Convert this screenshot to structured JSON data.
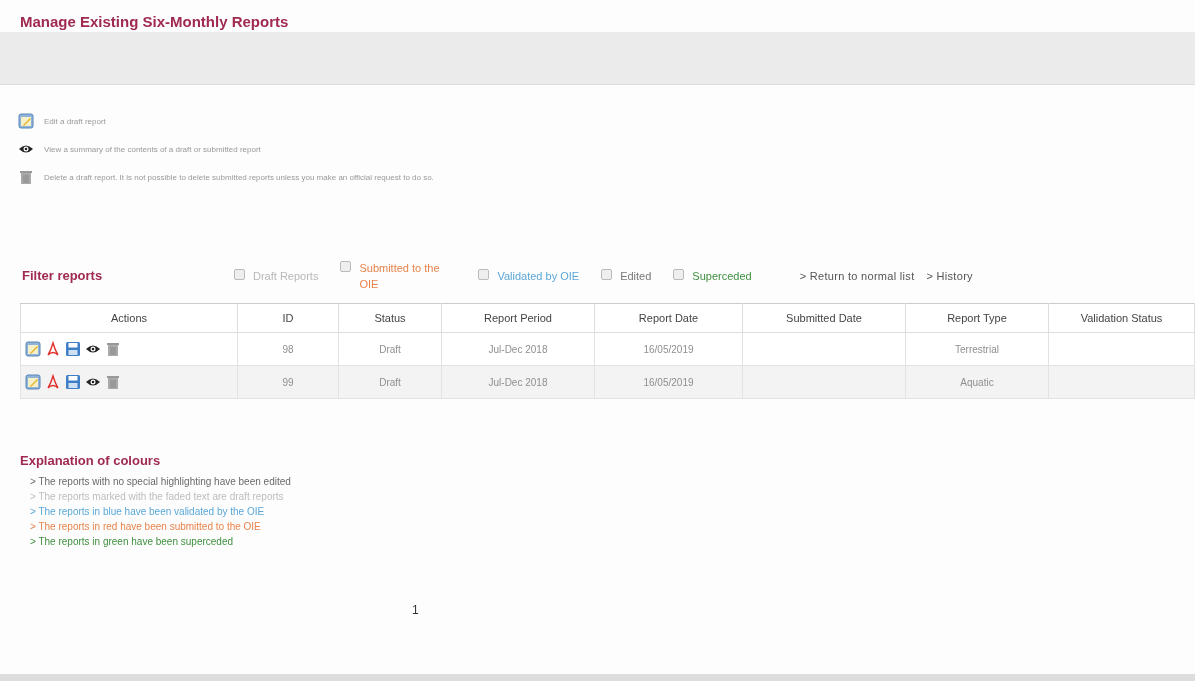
{
  "page": {
    "title": "Manage Existing Six-Monthly Reports"
  },
  "legend": [
    {
      "kind": "edit",
      "text": "Edit a draft report"
    },
    {
      "kind": "view",
      "text": "View a summary of the contents of a draft or submitted report"
    },
    {
      "kind": "delete",
      "text": "Delete a draft report. It is not possible to delete submitted reports unless you make an official request to do so."
    }
  ],
  "filters": {
    "label": "Filter reports",
    "options": [
      {
        "label": "Draft Reports",
        "checked": false,
        "color": "#b8b8b8"
      },
      {
        "label": "Submitted to the OIE",
        "checked": false,
        "color": "#e8834a"
      },
      {
        "label": "Validated by OIE",
        "checked": false,
        "color": "#5aa7d8"
      },
      {
        "label": "Edited",
        "checked": false,
        "color": "#777777"
      },
      {
        "label": "Superceded",
        "checked": false,
        "color": "#3f8f3f"
      }
    ],
    "links": [
      "> Return to normal list",
      "> History"
    ]
  },
  "table": {
    "columns": [
      "Actions",
      "ID",
      "Status",
      "Report Period",
      "Report Date",
      "Submitted Date",
      "Report Type",
      "Validation Status"
    ],
    "rows": [
      {
        "kind": "draft",
        "cells": [
          "",
          "98",
          "Draft",
          "Jul-Dec 2018",
          "16/05/2019",
          "",
          "Terrestrial",
          ""
        ]
      },
      {
        "kind": "draft",
        "cells": [
          "",
          "99",
          "Draft",
          "Jul-Dec 2018",
          "16/05/2019",
          "",
          "Aquatic",
          ""
        ]
      }
    ]
  },
  "explanation": {
    "title": "Explanation of colours",
    "lines": [
      {
        "text": "> The reports with no special highlighting have been edited",
        "color": "#6a6a6a"
      },
      {
        "text": "> The reports marked with the faded text are draft reports",
        "color": "#bdbdbd"
      },
      {
        "text": "> The reports in blue have been validated by the OIE",
        "color": "#5aa7d8"
      },
      {
        "text": "> The reports in red have been submitted to the OIE",
        "color": "#e8834a"
      },
      {
        "text": "> The reports in green have been superceded",
        "color": "#3f8f3f"
      }
    ]
  },
  "pagination": {
    "pages": [
      {
        "label": "1",
        "selected": true
      }
    ]
  }
}
